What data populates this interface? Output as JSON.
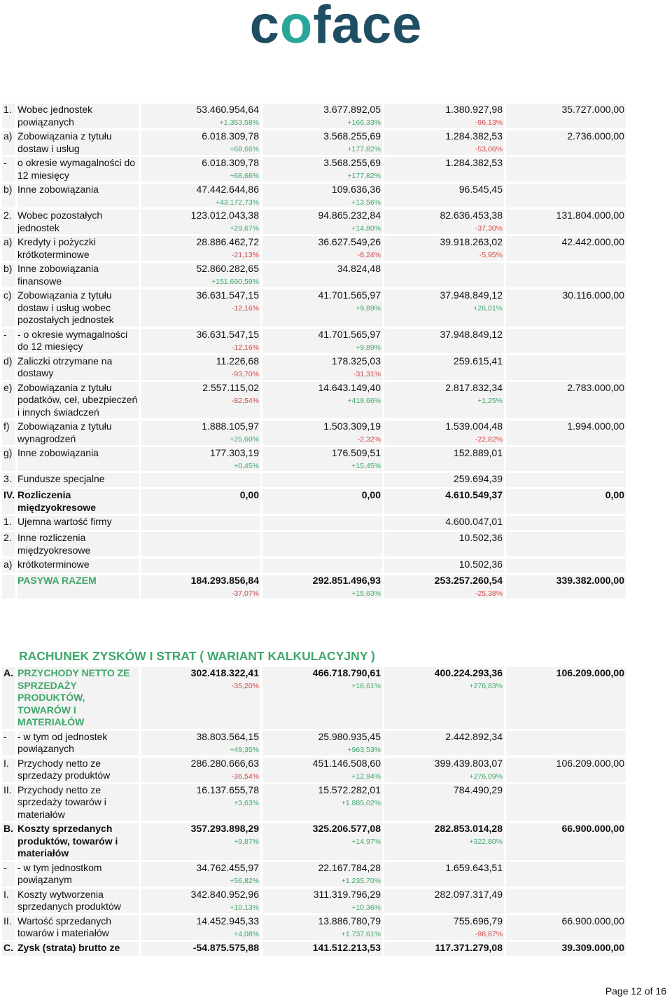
{
  "brand": {
    "logo_text": "coface",
    "color": "#1f4e63",
    "accent": "#2aa59a"
  },
  "colors": {
    "positive": "#3fa86a",
    "negative": "#d64545",
    "heading": "#3fa86a"
  },
  "table1": [
    {
      "m": "1.",
      "label": "Wobec jednostek powiązanych",
      "c1": "53.460.954,64",
      "p1": "+1.353,58%",
      "c2": "3.677.892,05",
      "p2": "+166,33%",
      "c3": "1.380.927,98",
      "p3": "-96,13%",
      "c4": "35.727.000,00"
    },
    {
      "m": "a)",
      "label": "Zobowiązania z tytułu dostaw i usług",
      "c1": "6.018.309,78",
      "p1": "+68,66%",
      "c2": "3.568.255,69",
      "p2": "+177,82%",
      "c3": "1.284.382,53",
      "p3": "-53,06%",
      "c4": "2.736.000,00"
    },
    {
      "m": "-",
      "label": "o okresie wymagalności do 12 miesięcy",
      "c1": "6.018.309,78",
      "p1": "+68,66%",
      "c2": "3.568.255,69",
      "p2": "+177,82%",
      "c3": "1.284.382,53",
      "p3": "",
      "c4": ""
    },
    {
      "m": "b)",
      "label": "Inne zobowiązania",
      "c1": "47.442.644,86",
      "p1": "+43.172,73%",
      "c2": "109.636,36",
      "p2": "+13,56%",
      "c3": "96.545,45",
      "p3": "",
      "c4": ""
    },
    {
      "m": "2.",
      "label": "Wobec pozostałych jednostek",
      "c1": "123.012.043,38",
      "p1": "+29,67%",
      "c2": "94.865.232,84",
      "p2": "+14,80%",
      "c3": "82.636.453,38",
      "p3": "-37,30%",
      "c4": "131.804.000,00"
    },
    {
      "m": "a)",
      "label": "Kredyty i pożyczki krótkoterminowe",
      "c1": "28.886.462,72",
      "p1": "-21,13%",
      "c2": "36.627.549,26",
      "p2": "-8,24%",
      "c3": "39.918.263,02",
      "p3": "-5,95%",
      "c4": "42.442.000,00"
    },
    {
      "m": "b)",
      "label": "Inne zobowiązania finansowe",
      "c1": "52.860.282,65",
      "p1": "+151.690,59%",
      "c2": "34.824,48",
      "p2": "",
      "c3": "",
      "p3": "",
      "c4": ""
    },
    {
      "m": "c)",
      "label": "Zobowiązania z tytułu dostaw i usług wobec pozostałych jednostek",
      "c1": "36.631.547,15",
      "p1": "-12,16%",
      "c2": "41.701.565,97",
      "p2": "+9,89%",
      "c3": "37.948.849,12",
      "p3": "+26,01%",
      "c4": "30.116.000,00"
    },
    {
      "m": "-",
      "label": "- o okresie wymagalności do 12 miesięcy",
      "c1": "36.631.547,15",
      "p1": "-12,16%",
      "c2": "41.701.565,97",
      "p2": "+9,89%",
      "c3": "37.948.849,12",
      "p3": "",
      "c4": ""
    },
    {
      "m": "d)",
      "label": "Zaliczki otrzymane na dostawy",
      "c1": "11.226,68",
      "p1": "-93,70%",
      "c2": "178.325,03",
      "p2": "-31,31%",
      "c3": "259.615,41",
      "p3": "",
      "c4": ""
    },
    {
      "m": "e)",
      "label": "Zobowiązania z tytułu podatków, ceł, ubezpieczeń i innych świadczeń",
      "c1": "2.557.115,02",
      "p1": "-82,54%",
      "c2": "14.643.149,40",
      "p2": "+419,66%",
      "c3": "2.817.832,34",
      "p3": "+1,25%",
      "c4": "2.783.000,00"
    },
    {
      "m": "f)",
      "label": "Zobowiązania z tytułu wynagrodzeń",
      "c1": "1.888.105,97",
      "p1": "+25,60%",
      "c2": "1.503.309,19",
      "p2": "-2,32%",
      "c3": "1.539.004,48",
      "p3": "-22,82%",
      "c4": "1.994.000,00"
    },
    {
      "m": "g)",
      "label": "Inne zobowiązania",
      "c1": "177.303,19",
      "p1": "+0,45%",
      "c2": "176.509,51",
      "p2": "+15,45%",
      "c3": "152.889,01",
      "p3": "",
      "c4": ""
    },
    {
      "m": "3.",
      "label": "Fundusze specjalne",
      "c1": "",
      "p1": "",
      "c2": "",
      "p2": "",
      "c3": "259.694,39",
      "p3": "",
      "c4": ""
    },
    {
      "m": "IV.",
      "label": "Rozliczenia międzyokresowe",
      "bold": true,
      "c1": "0,00",
      "p1": "",
      "c2": "0,00",
      "p2": "",
      "c3": "4.610.549,37",
      "p3": "",
      "c4": "0,00"
    },
    {
      "m": "1.",
      "label": "Ujemna wartość firmy",
      "c1": "",
      "p1": "",
      "c2": "",
      "p2": "",
      "c3": "4.600.047,01",
      "p3": "",
      "c4": ""
    },
    {
      "m": "2.",
      "label": "Inne rozliczenia międzyokresowe",
      "c1": "",
      "p1": "",
      "c2": "",
      "p2": "",
      "c3": "10.502,36",
      "p3": "",
      "c4": ""
    },
    {
      "m": "a)",
      "label": "krótkoterminowe",
      "c1": "",
      "p1": "",
      "c2": "",
      "p2": "",
      "c3": "10.502,36",
      "p3": "",
      "c4": ""
    },
    {
      "m": "",
      "label": "PASYWA RAZEM",
      "green": true,
      "bold": true,
      "c1": "184.293.856,84",
      "p1": "-37,07%",
      "c2": "292.851.496,93",
      "p2": "+15,63%",
      "c3": "253.257.260,54",
      "p3": "-25,38%",
      "c4": "339.382.000,00"
    }
  ],
  "section2_title": "RACHUNEK ZYSKÓW I STRAT ( WARIANT KALKULACYJNY )",
  "table2": [
    {
      "m": "A.",
      "label": "PRZYCHODY NETTO ZE SPRZEDAŻY PRODUKTÓW, TOWARÓW I MATERIAŁÓW",
      "green": true,
      "bold": true,
      "c1": "302.418.322,41",
      "p1": "-35,20%",
      "c2": "466.718.790,61",
      "p2": "+16,61%",
      "c3": "400.224.293,36",
      "p3": "+276,83%",
      "c4": "106.209.000,00"
    },
    {
      "m": "-",
      "label": "- w tym od jednostek powiązanych",
      "c1": "38.803.564,15",
      "p1": "+49,35%",
      "c2": "25.980.935,45",
      "p2": "+963,53%",
      "c3": "2.442.892,34",
      "p3": "",
      "c4": ""
    },
    {
      "m": "I.",
      "label": "Przychody netto ze sprzedaży produktów",
      "c1": "286.280.666,63",
      "p1": "-36,54%",
      "c2": "451.146.508,60",
      "p2": "+12,94%",
      "c3": "399.439.803,07",
      "p3": "+276,09%",
      "c4": "106.209.000,00"
    },
    {
      "m": "II.",
      "label": "Przychody netto ze sprzedaży towarów i materiałów",
      "c1": "16.137.655,78",
      "p1": "+3,63%",
      "c2": "15.572.282,01",
      "p2": "+1.885,02%",
      "c3": "784.490,29",
      "p3": "",
      "c4": ""
    },
    {
      "m": "B.",
      "label": "Koszty sprzedanych produktów, towarów i materiałów",
      "bold": true,
      "c1": "357.293.898,29",
      "p1": "+9,87%",
      "c2": "325.206.577,08",
      "p2": "+14,97%",
      "c3": "282.853.014,28",
      "p3": "+322,80%",
      "c4": "66.900.000,00"
    },
    {
      "m": "-",
      "label": "- w tym jednostkom powiązanym",
      "c1": "34.762.455,97",
      "p1": "+56,82%",
      "c2": "22.167.784,28",
      "p2": "+1.235,70%",
      "c3": "1.659.643,51",
      "p3": "",
      "c4": ""
    },
    {
      "m": "I.",
      "label": "Koszty wytworzenia sprzedanych produktów",
      "c1": "342.840.952,96",
      "p1": "+10,13%",
      "c2": "311.319.796,29",
      "p2": "+10,36%",
      "c3": "282.097.317,49",
      "p3": "",
      "c4": ""
    },
    {
      "m": "II.",
      "label": "Wartość sprzedanych towarów i materiałów",
      "c1": "14.452.945,33",
      "p1": "+4,08%",
      "c2": "13.886.780,79",
      "p2": "+1.737,61%",
      "c3": "755.696,79",
      "p3": "-98,87%",
      "c4": "66.900.000,00"
    },
    {
      "m": "C.",
      "label": "Zysk (strata) brutto ze",
      "bold": true,
      "c1": "-54.875.575,88",
      "p1": "",
      "c2": "141.512.213,53",
      "p2": "",
      "c3": "117.371.279,08",
      "p3": "",
      "c4": "39.309.000,00"
    }
  ],
  "page_label": "Page 12 of 16"
}
